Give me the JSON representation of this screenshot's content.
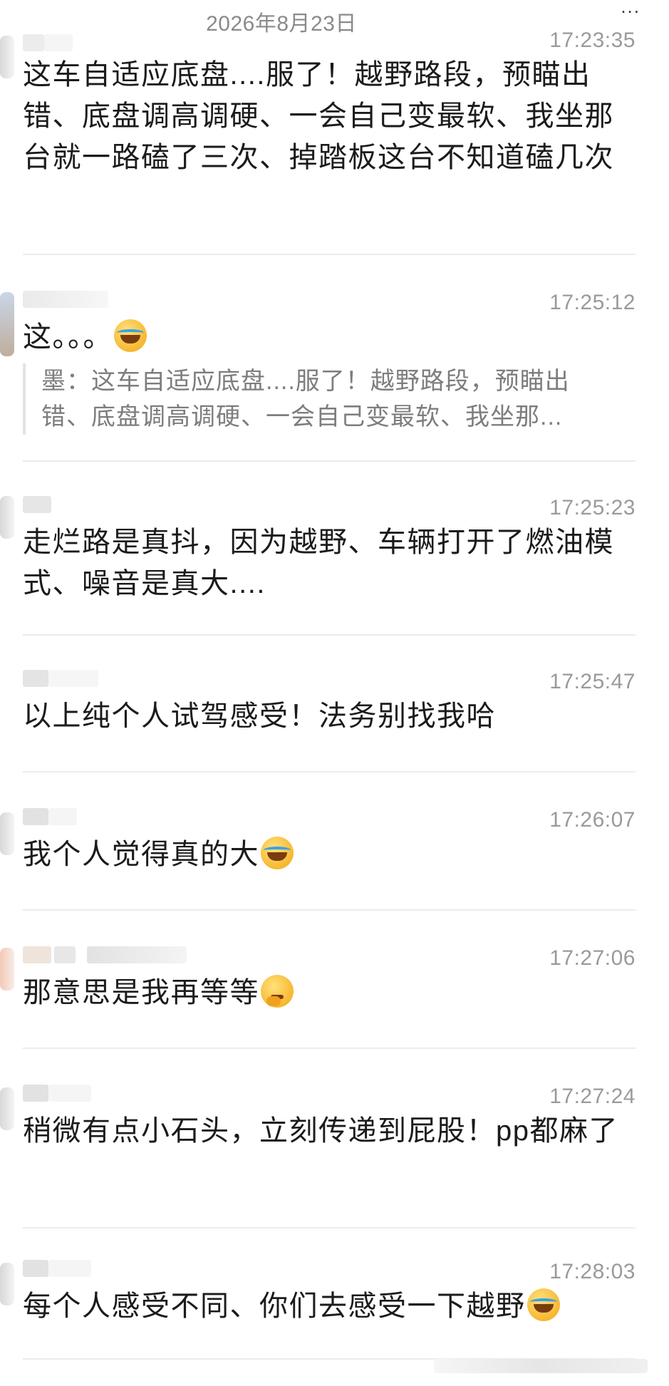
{
  "chat": {
    "date_header": "2026年8月23日",
    "top_overflow": "...",
    "messages": [
      {
        "time": "17:23:35",
        "text": "这车自适应底盘....服了！越野路段，预瞄出错、底盘调高调硬、一会自己变最软、我坐那台就一路磕了三次、掉踏板这台不知道磕几次"
      },
      {
        "time": "17:25:12",
        "text": "这。。。",
        "emoji": "face-with-tears-emoji",
        "quote": {
          "line1": "墨：这车自适应底盘....服了！越野路段，预瞄出",
          "line2": "错、底盘调高调硬、一会自己变最软、我坐那..."
        }
      },
      {
        "time": "17:25:23",
        "text": "走烂路是真抖，因为越野、车辆打开了燃油模式、噪音是真大...."
      },
      {
        "time": "17:25:47",
        "text": "以上纯个人试驾感受！法务别找我哈"
      },
      {
        "time": "17:26:07",
        "text": "我个人觉得真的大",
        "emoji": "face-with-tears-emoji"
      },
      {
        "time": "17:27:06",
        "text": "那意思是我再等等",
        "emoji": "thinking-face-emoji"
      },
      {
        "time": "17:27:24",
        "text": "稍微有点小石头，立刻传递到屁股！pp都麻了"
      },
      {
        "time": "17:28:03",
        "text": "每个人感受不同、你们去感受一下越野",
        "emoji": "face-with-tears-emoji"
      }
    ]
  }
}
